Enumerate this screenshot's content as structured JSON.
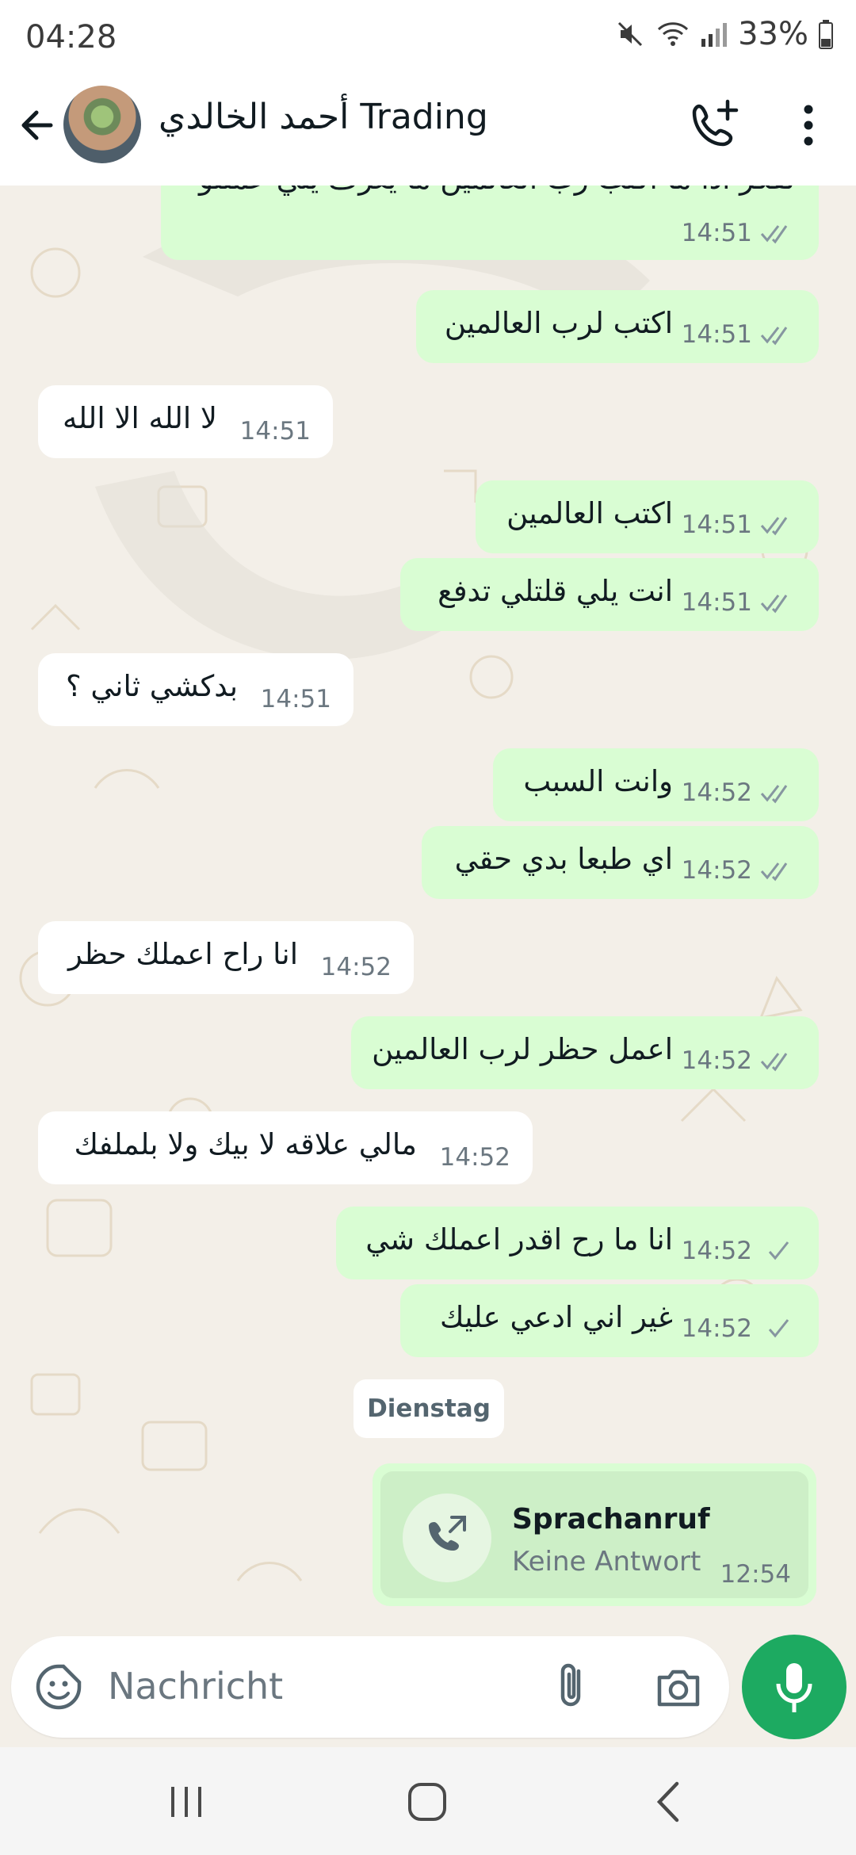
{
  "status_bar": {
    "time": "04:28",
    "battery": "33%"
  },
  "header": {
    "title": "أحمد الخالدي Trading"
  },
  "messages": [
    {
      "text": "تفكر اذا ما اكتب رب العالمين ما يعرف يلي عملتو",
      "time": "14:51",
      "direction": "out",
      "status": "read"
    },
    {
      "text": "اكتب لرب العالمين",
      "time": "14:51",
      "direction": "out",
      "status": "read"
    },
    {
      "text": "لا الله الا الله",
      "time": "14:51",
      "direction": "in"
    },
    {
      "text": "اكتب العالمين",
      "time": "14:51",
      "direction": "out",
      "status": "read"
    },
    {
      "text": "انت يلي قلتلي تدفع",
      "time": "14:51",
      "direction": "out",
      "status": "read"
    },
    {
      "text": "بدكشي ثاني ؟",
      "time": "14:51",
      "direction": "in"
    },
    {
      "text": "وانت السبب",
      "time": "14:52",
      "direction": "out",
      "status": "read"
    },
    {
      "text": "اي طبعا بدي حقي",
      "time": "14:52",
      "direction": "out",
      "status": "read"
    },
    {
      "text": "انا راح اعملك حظر",
      "time": "14:52",
      "direction": "in"
    },
    {
      "text": "اعمل حظر لرب العالمين",
      "time": "14:52",
      "direction": "out",
      "status": "read"
    },
    {
      "text": "مالي علاقه لا بيك ولا بلملفك",
      "time": "14:52",
      "direction": "in"
    },
    {
      "text": "انا ما رح اقدر اعملك شي",
      "time": "14:52",
      "direction": "out",
      "status": "sent"
    },
    {
      "text": "غير اني ادعي عليك",
      "time": "14:52",
      "direction": "out",
      "status": "sent"
    }
  ],
  "date_divider": "Dienstag",
  "call_card": {
    "title": "Sprachanruf",
    "subtitle": "Keine Antwort",
    "time": "12:54"
  },
  "input": {
    "placeholder": "Nachricht"
  },
  "colors": {
    "outgoing_bubble": "#d9fdd3",
    "incoming_bubble": "#ffffff",
    "mic_button": "#1daa61",
    "tick_read": "#8696a0"
  }
}
